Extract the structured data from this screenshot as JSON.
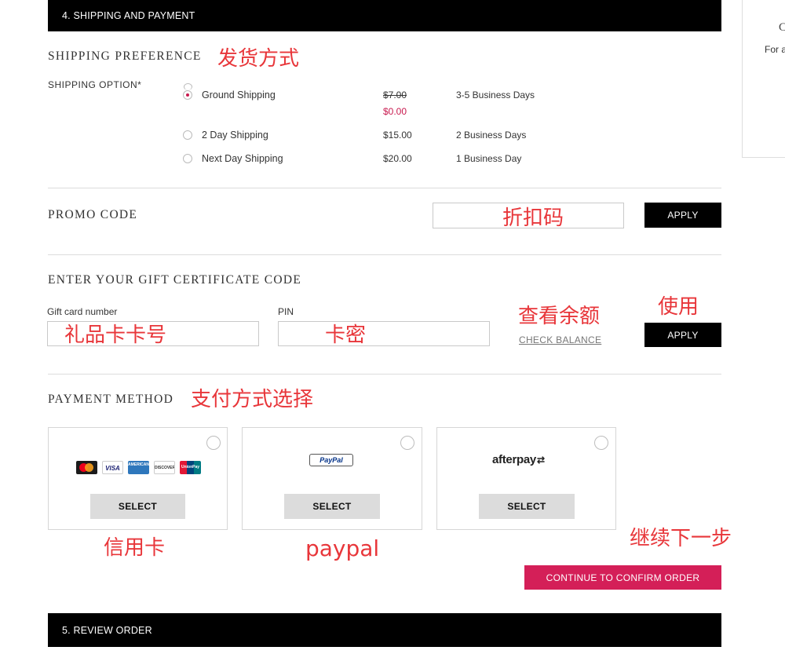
{
  "sections": {
    "shipping_payment_header": "4. SHIPPING AND PAYMENT",
    "review_order_header": "5. REVIEW ORDER"
  },
  "side_panel": {
    "text_top": "C",
    "text_sub": "For a"
  },
  "shipping": {
    "heading": "SHIPPING PREFERENCE",
    "option_label": "SHIPPING OPTION*",
    "options": [
      {
        "name": "Ground Shipping",
        "old_price": "$7.00",
        "price": "$0.00",
        "time": "3-5 Business Days",
        "selected": true
      },
      {
        "name": "2 Day Shipping",
        "price": "$15.00",
        "time": "2 Business Days",
        "selected": false
      },
      {
        "name": "Next Day Shipping",
        "price": "$20.00",
        "time": "1 Business Day",
        "selected": false
      }
    ]
  },
  "promo": {
    "heading": "PROMO CODE",
    "input_value": "",
    "apply_label": "APPLY"
  },
  "gift": {
    "heading": "ENTER YOUR GIFT CERTIFICATE CODE",
    "card_number_label": "Gift card number",
    "pin_label": "PIN",
    "check_balance_label": "CHECK BALANCE",
    "apply_label": "APPLY"
  },
  "payment": {
    "heading": "PAYMENT METHOD",
    "cards": [
      {
        "id": "credit-card",
        "select_label": "SELECT",
        "logos": [
          "MasterCard",
          "VISA",
          "AMERICAN EXPRESS",
          "DISCOVER",
          "UnionPay"
        ]
      },
      {
        "id": "paypal",
        "select_label": "SELECT",
        "logo_text": "PayPal"
      },
      {
        "id": "afterpay",
        "select_label": "SELECT",
        "logo_text": "afterpay"
      }
    ],
    "continue_label": "CONTINUE TO CONFIRM ORDER"
  },
  "annotations": {
    "shipping_method": "发货方式",
    "promo_code": "折扣码",
    "check_balance": "查看余额",
    "use": "使用",
    "gift_card_number": "礼品卡卡号",
    "card_pin": "卡密",
    "payment_method_select": "支付方式选择",
    "credit_card": "信用卡",
    "paypal": "paypal",
    "next_step": "继续下一步"
  },
  "colors": {
    "accent_pink": "#d41f58",
    "annotation_red": "#e8363a",
    "header_black": "#000000"
  }
}
